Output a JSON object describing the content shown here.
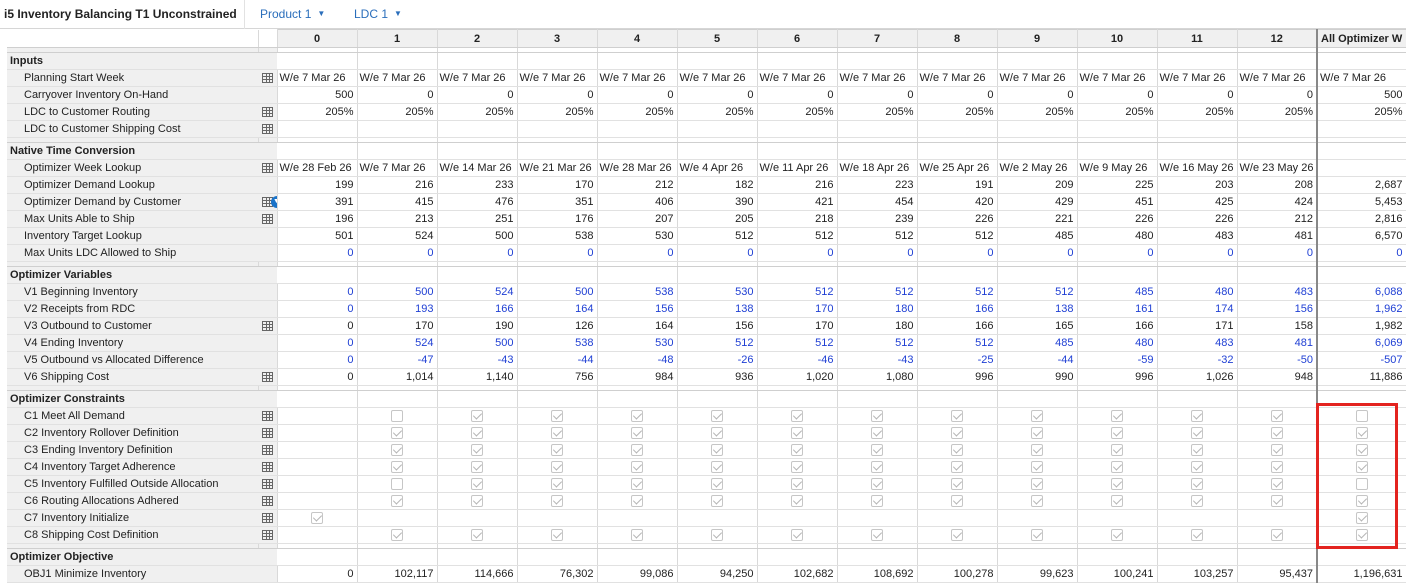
{
  "header": {
    "title": "i5 Inventory Balancing T1 Unconstrained",
    "product_label": "Product 1",
    "ldc_label": "LDC 1"
  },
  "columns": [
    "0",
    "1",
    "2",
    "3",
    "4",
    "5",
    "6",
    "7",
    "8",
    "9",
    "10",
    "11",
    "12",
    "All Optimizer W"
  ],
  "sections": [
    {
      "label": "Inputs",
      "rows": [
        {
          "label": "Planning Start Week",
          "icon": true,
          "kind": "date",
          "values": [
            "W/e 7 Mar 26",
            "W/e 7 Mar 26",
            "W/e 7 Mar 26",
            "W/e 7 Mar 26",
            "W/e 7 Mar 26",
            "W/e 7 Mar 26",
            "W/e 7 Mar 26",
            "W/e 7 Mar 26",
            "W/e 7 Mar 26",
            "W/e 7 Mar 26",
            "W/e 7 Mar 26",
            "W/e 7 Mar 26",
            "W/e 7 Mar 26",
            "W/e 7 Mar 26"
          ]
        },
        {
          "label": "Carryover Inventory On-Hand",
          "icon": false,
          "kind": "num",
          "values": [
            "500",
            "0",
            "0",
            "0",
            "0",
            "0",
            "0",
            "0",
            "0",
            "0",
            "0",
            "0",
            "0",
            "500"
          ]
        },
        {
          "label": "LDC to Customer Routing",
          "icon": true,
          "kind": "num",
          "values": [
            "205%",
            "205%",
            "205%",
            "205%",
            "205%",
            "205%",
            "205%",
            "205%",
            "205%",
            "205%",
            "205%",
            "205%",
            "205%",
            "205%"
          ]
        },
        {
          "label": "LDC to Customer Shipping Cost",
          "icon": true,
          "kind": "num",
          "values": [
            "",
            "",
            "",
            "",
            "",
            "",
            "",
            "",
            "",
            "",
            "",
            "",
            "",
            ""
          ]
        }
      ]
    },
    {
      "label": "Native Time Conversion",
      "rows": [
        {
          "label": "Optimizer Week Lookup",
          "icon": true,
          "kind": "date",
          "values": [
            "W/e 28 Feb 26",
            "W/e 7 Mar 26",
            "W/e 14 Mar 26",
            "W/e 21 Mar 26",
            "W/e 28 Mar 26",
            "W/e 4 Apr 26",
            "W/e 11 Apr 26",
            "W/e 18 Apr 26",
            "W/e 25 Apr 26",
            "W/e 2 May 26",
            "W/e 9 May 26",
            "W/e 16 May 26",
            "W/e 23 May 26",
            ""
          ]
        },
        {
          "label": "Optimizer Demand Lookup",
          "icon": false,
          "kind": "num",
          "values": [
            "199",
            "216",
            "233",
            "170",
            "212",
            "182",
            "216",
            "223",
            "191",
            "209",
            "225",
            "203",
            "208",
            "2,687"
          ]
        },
        {
          "label": "Optimizer Demand by Customer",
          "icon": true,
          "dropdown": true,
          "kind": "num",
          "values": [
            "391",
            "415",
            "476",
            "351",
            "406",
            "390",
            "421",
            "454",
            "420",
            "429",
            "451",
            "425",
            "424",
            "5,453"
          ]
        },
        {
          "label": "Max Units Able to Ship",
          "icon": true,
          "kind": "num",
          "values": [
            "196",
            "213",
            "251",
            "176",
            "207",
            "205",
            "218",
            "239",
            "226",
            "221",
            "226",
            "226",
            "212",
            "2,816"
          ]
        },
        {
          "label": "Inventory Target Lookup",
          "icon": false,
          "kind": "num",
          "values": [
            "501",
            "524",
            "500",
            "538",
            "530",
            "512",
            "512",
            "512",
            "512",
            "485",
            "480",
            "483",
            "481",
            "6,570"
          ]
        },
        {
          "label": "Max Units LDC Allowed to Ship",
          "icon": false,
          "kind": "num",
          "blue": true,
          "values": [
            "0",
            "0",
            "0",
            "0",
            "0",
            "0",
            "0",
            "0",
            "0",
            "0",
            "0",
            "0",
            "0",
            "0"
          ]
        }
      ]
    },
    {
      "label": "Optimizer Variables",
      "rows": [
        {
          "label": "V1 Beginning Inventory",
          "icon": false,
          "kind": "num",
          "blue": true,
          "values": [
            "0",
            "500",
            "524",
            "500",
            "538",
            "530",
            "512",
            "512",
            "512",
            "512",
            "485",
            "480",
            "483",
            "6,088"
          ]
        },
        {
          "label": "V2 Receipts from RDC",
          "icon": false,
          "kind": "num",
          "blue": true,
          "values": [
            "0",
            "193",
            "166",
            "164",
            "156",
            "138",
            "170",
            "180",
            "166",
            "138",
            "161",
            "174",
            "156",
            "1,962"
          ]
        },
        {
          "label": "V3 Outbound to Customer",
          "icon": true,
          "kind": "num",
          "values": [
            "0",
            "170",
            "190",
            "126",
            "164",
            "156",
            "170",
            "180",
            "166",
            "165",
            "166",
            "171",
            "158",
            "1,982"
          ]
        },
        {
          "label": "V4 Ending Inventory",
          "icon": false,
          "kind": "num",
          "blue": true,
          "values": [
            "0",
            "524",
            "500",
            "538",
            "530",
            "512",
            "512",
            "512",
            "512",
            "485",
            "480",
            "483",
            "481",
            "6,069"
          ]
        },
        {
          "label": "V5 Outbound vs Allocated Difference",
          "icon": false,
          "kind": "num",
          "blue": true,
          "values": [
            "0",
            "-47",
            "-43",
            "-44",
            "-48",
            "-26",
            "-46",
            "-43",
            "-25",
            "-44",
            "-59",
            "-32",
            "-50",
            "-507"
          ]
        },
        {
          "label": "V6 Shipping Cost",
          "icon": true,
          "kind": "num",
          "values": [
            "0",
            "1,014",
            "1,140",
            "756",
            "984",
            "936",
            "1,020",
            "1,080",
            "996",
            "990",
            "996",
            "1,026",
            "948",
            "11,886"
          ]
        }
      ]
    },
    {
      "label": "Optimizer Constraints",
      "rows": [
        {
          "label": "C1 Meet All Demand",
          "icon": true,
          "kind": "chk",
          "values": [
            "",
            "u",
            "c",
            "c",
            "c",
            "c",
            "c",
            "c",
            "c",
            "c",
            "c",
            "c",
            "c",
            "u"
          ]
        },
        {
          "label": "C2 Inventory Rollover Definition",
          "icon": true,
          "kind": "chk",
          "values": [
            "",
            "c",
            "c",
            "c",
            "c",
            "c",
            "c",
            "c",
            "c",
            "c",
            "c",
            "c",
            "c",
            "c"
          ]
        },
        {
          "label": "C3 Ending Inventory Definition",
          "icon": true,
          "kind": "chk",
          "values": [
            "",
            "c",
            "c",
            "c",
            "c",
            "c",
            "c",
            "c",
            "c",
            "c",
            "c",
            "c",
            "c",
            "c"
          ]
        },
        {
          "label": "C4 Inventory Target Adherence",
          "icon": true,
          "kind": "chk",
          "values": [
            "",
            "c",
            "c",
            "c",
            "c",
            "c",
            "c",
            "c",
            "c",
            "c",
            "c",
            "c",
            "c",
            "c"
          ]
        },
        {
          "label": "C5 Inventory Fulfilled Outside Allocation",
          "icon": true,
          "kind": "chk",
          "values": [
            "",
            "u",
            "c",
            "c",
            "c",
            "c",
            "c",
            "c",
            "c",
            "c",
            "c",
            "c",
            "c",
            "u"
          ]
        },
        {
          "label": "C6 Routing Allocations Adhered",
          "icon": true,
          "kind": "chk",
          "values": [
            "",
            "c",
            "c",
            "c",
            "c",
            "c",
            "c",
            "c",
            "c",
            "c",
            "c",
            "c",
            "c",
            "c"
          ]
        },
        {
          "label": "C7 Inventory Initialize",
          "icon": true,
          "kind": "chk",
          "values": [
            "c",
            "",
            "",
            "",
            "",
            "",
            "",
            "",
            "",
            "",
            "",
            "",
            "",
            "c"
          ]
        },
        {
          "label": "C8 Shipping Cost Definition",
          "icon": true,
          "kind": "chk",
          "values": [
            "",
            "c",
            "c",
            "c",
            "c",
            "c",
            "c",
            "c",
            "c",
            "c",
            "c",
            "c",
            "c",
            "c"
          ]
        }
      ]
    },
    {
      "label": "Optimizer Objective",
      "rows": [
        {
          "label": "OBJ1 Minimize Inventory",
          "icon": false,
          "kind": "num",
          "values": [
            "0",
            "102,117",
            "114,666",
            "76,302",
            "99,086",
            "94,250",
            "102,682",
            "108,692",
            "100,278",
            "99,623",
            "100,241",
            "103,257",
            "95,437",
            "1,196,631"
          ]
        }
      ]
    }
  ]
}
